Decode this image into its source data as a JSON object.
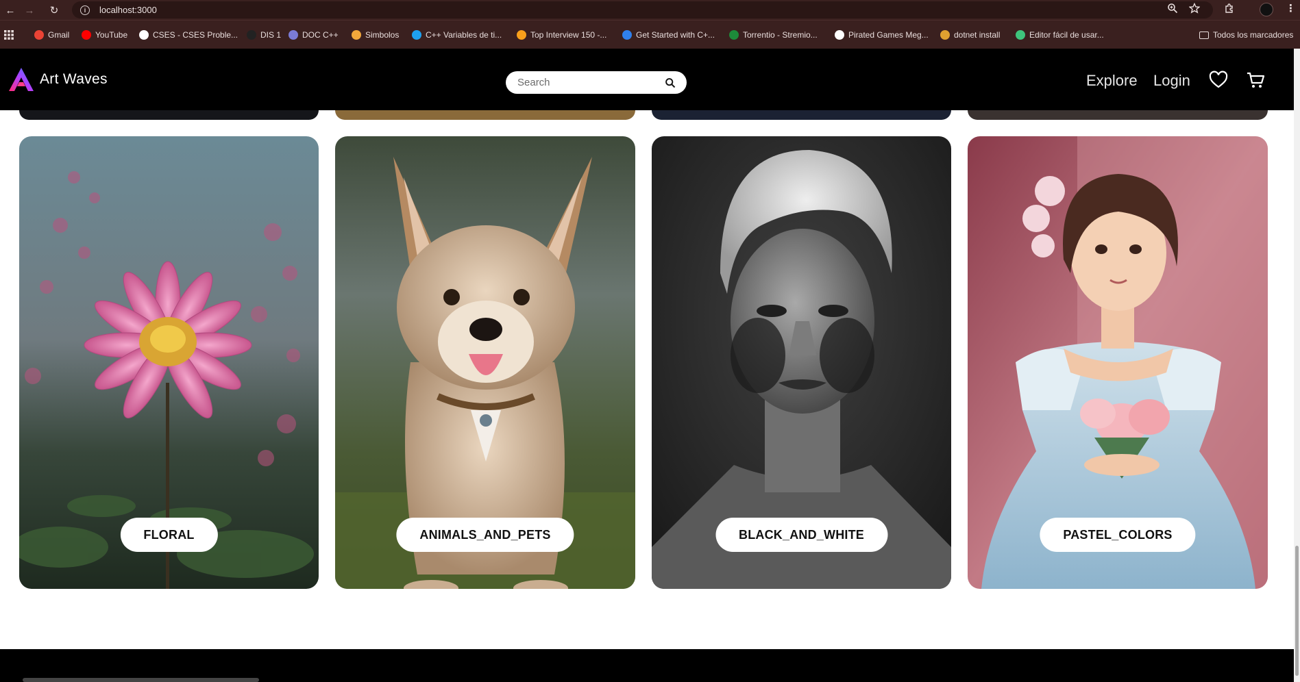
{
  "browser": {
    "url": "localhost:3000",
    "bookmarks": [
      {
        "label": "Gmail",
        "icon": "gmail-icon",
        "color": "#ea4335"
      },
      {
        "label": "YouTube",
        "icon": "youtube-icon",
        "color": "#ff0000"
      },
      {
        "label": "CSES - CSES Proble...",
        "icon": "cses-icon",
        "color": "#ffffff"
      },
      {
        "label": "DIS 1",
        "icon": "github-icon",
        "color": "#222222"
      },
      {
        "label": "DOC C++",
        "icon": "doc-icon",
        "color": "#7b7bd6"
      },
      {
        "label": "Simbolos",
        "icon": "simbolos-icon",
        "color": "#f2a73b"
      },
      {
        "label": "C++ Variables de ti...",
        "icon": "edge-icon",
        "color": "#1ea1f1"
      },
      {
        "label": "Top Interview 150 -...",
        "icon": "leetcode-icon",
        "color": "#f89f1b"
      },
      {
        "label": "Get Started with C+...",
        "icon": "vscode-icon",
        "color": "#2f80ed"
      },
      {
        "label": "Torrentio - Stremio...",
        "icon": "torrentio-icon",
        "color": "#1d8a3a"
      },
      {
        "label": "Pirated Games Meg...",
        "icon": "pirated-icon",
        "color": "#ffffff"
      },
      {
        "label": "dotnet install",
        "icon": "dotnet-icon",
        "color": "#e0a030"
      },
      {
        "label": "Editor fácil de usar...",
        "icon": "editor-icon",
        "color": "#3ec47c"
      },
      {
        "label": "Todos los marcadores",
        "icon": "folder-icon",
        "color": "#e9dedd"
      }
    ]
  },
  "header": {
    "brand": "Art Waves",
    "search_placeholder": "Search",
    "nav": {
      "explore": "Explore",
      "login": "Login"
    }
  },
  "categories": [
    {
      "label": "FLORAL",
      "icon": "flower-image"
    },
    {
      "label": "ANIMALS_AND_PETS",
      "icon": "dog-image"
    },
    {
      "label": "BLACK_AND_WHITE",
      "icon": "portrait-image"
    },
    {
      "label": "PASTEL_COLORS",
      "icon": "girl-painting-image"
    }
  ]
}
